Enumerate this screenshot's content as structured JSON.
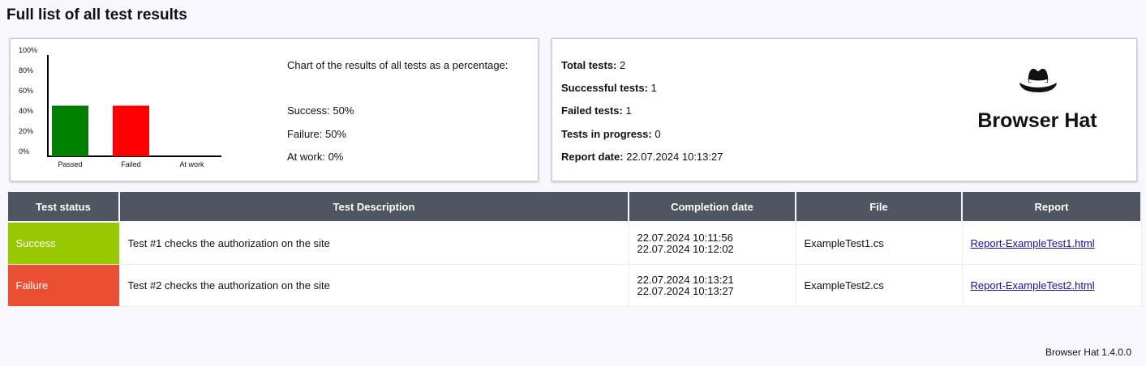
{
  "page": {
    "title": "Full list of all test results",
    "footer": "Browser Hat 1.4.0.0"
  },
  "chart_panel": {
    "caption": "Chart of the results of all tests as a percentage:",
    "success_text": "Success: 50%",
    "failure_text": "Failure: 50%",
    "atwork_text": "At work: 0%"
  },
  "chart_data": {
    "type": "bar",
    "categories": [
      "Passed",
      "Failed",
      "At work"
    ],
    "values": [
      50,
      50,
      0
    ],
    "colors": [
      "#008000",
      "#ff0000",
      "#888888"
    ],
    "ylim": [
      0,
      100
    ],
    "yticks": [
      "0%",
      "20%",
      "40%",
      "60%",
      "80%",
      "100%"
    ],
    "title": "",
    "xlabel": "",
    "ylabel": ""
  },
  "stats": {
    "total_label": "Total tests:",
    "total_value": "2",
    "success_label": "Successful tests:",
    "success_value": "1",
    "failed_label": "Failed tests:",
    "failed_value": "1",
    "progress_label": "Tests in progress:",
    "progress_value": "0",
    "date_label": "Report date:",
    "date_value": "22.07.2024 10:13:27"
  },
  "brand": {
    "name": "Browser Hat",
    "logo_icon": "hat-icon"
  },
  "table": {
    "headers": [
      "Test status",
      "Test Description",
      "Completion date",
      "File",
      "Report"
    ],
    "rows": [
      {
        "status": "Success",
        "status_color": "#97c800",
        "description": "Test #1 checks the authorization on the site",
        "date_start": "22.07.2024 10:11:56",
        "date_end": "22.07.2024 10:12:02",
        "file": "ExampleTest1.cs",
        "report": "Report-ExampleTest1.html"
      },
      {
        "status": "Failure",
        "status_color": "#e84f33",
        "description": "Test #2 checks the authorization on the site",
        "date_start": "22.07.2024 10:13:21",
        "date_end": "22.07.2024 10:13:27",
        "file": "ExampleTest2.cs",
        "report": "Report-ExampleTest2.html"
      }
    ]
  }
}
